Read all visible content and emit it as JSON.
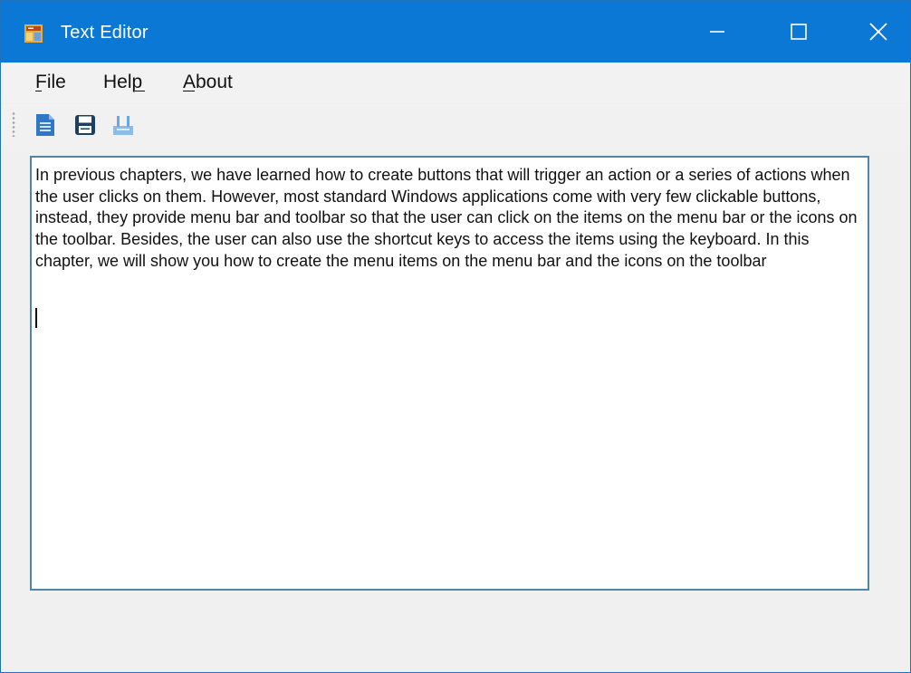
{
  "window": {
    "title": "Text Editor",
    "controls": {
      "minimize_icon": "minimize-icon",
      "maximize_icon": "maximize-icon",
      "close_icon": "close-icon"
    },
    "colors": {
      "titlebar": "#0a78d4",
      "editor_border": "#4f86a8"
    }
  },
  "menu": {
    "items": [
      {
        "label": "File"
      },
      {
        "label": "Help"
      },
      {
        "label": "About"
      }
    ]
  },
  "toolbar": {
    "items": [
      {
        "icon": "new-document-icon"
      },
      {
        "icon": "save-icon"
      },
      {
        "icon": "print-icon"
      }
    ]
  },
  "editor": {
    "text": "In previous chapters, we have learned how to create buttons that will trigger an action or a series of actions when the user clicks on them. However, most standard Windows applications come with very few clickable buttons, instead, they provide menu bar and toolbar so that the user can click on the items on the menu bar or the icons on the toolbar. Besides, the user can also use the shortcut keys to access the items using the keyboard. In this chapter, we will show you how to create the menu items on the menu bar and the icons on the toolbar"
  }
}
